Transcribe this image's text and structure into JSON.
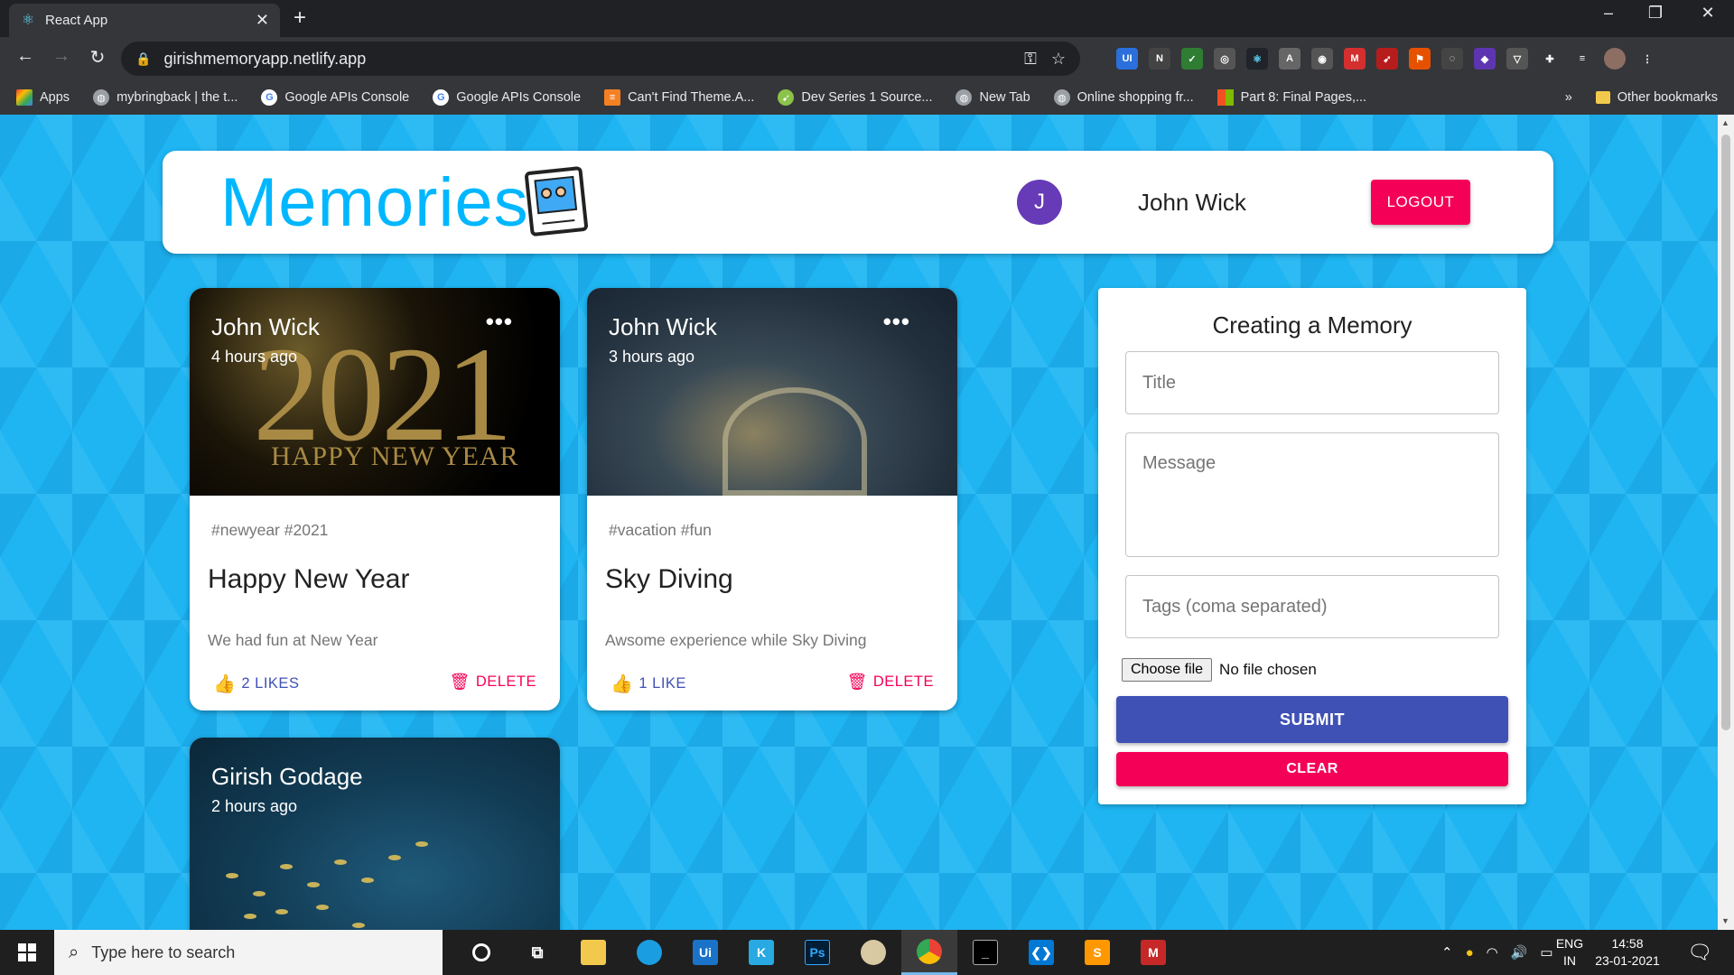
{
  "browser": {
    "tab_title": "React App",
    "tab_close": "✕",
    "new_tab": "+",
    "url": "girishmemoryapp.netlify.app",
    "window_controls": [
      "–",
      "❐",
      "✕"
    ]
  },
  "bookmarks": {
    "items": [
      {
        "label": "Apps",
        "icon": "apps-grid-icon",
        "color": "#ea4335"
      },
      {
        "label": "mybringback | the t...",
        "icon": "globe-icon",
        "color": "#9aa0a6"
      },
      {
        "label": "Google APIs Console",
        "icon": "google-icon",
        "color": "#ffffff"
      },
      {
        "label": "Google APIs Console",
        "icon": "google-icon",
        "color": "#ffffff"
      },
      {
        "label": "Can't Find Theme.A...",
        "icon": "stack-icon",
        "color": "#f48024"
      },
      {
        "label": "Dev Series 1 Source...",
        "icon": "rocket-icon",
        "color": "#8bc34a"
      },
      {
        "label": "New Tab",
        "icon": "globe-icon",
        "color": "#9aa0a6"
      },
      {
        "label": "Online shopping fr...",
        "icon": "globe-icon",
        "color": "#9aa0a6"
      },
      {
        "label": "Part 8: Final Pages,...",
        "icon": "microsoft-icon",
        "color": "#f25022"
      }
    ],
    "overflow": "»",
    "other": "Other bookmarks"
  },
  "header": {
    "brand": "Memories",
    "avatar_letter": "J",
    "user_name": "John Wick",
    "logout_label": "LOGOUT"
  },
  "posts": [
    {
      "author": "John Wick",
      "time": "4 hours ago",
      "image_text": "2021",
      "image_subtext": "HAPPY NEW YEAR",
      "tags": "#newyear #2021",
      "title": "Happy New Year",
      "message": "We had fun at New Year",
      "likes": "2 LIKES",
      "delete": "DELETE"
    },
    {
      "author": "John Wick",
      "time": "3 hours ago",
      "tags": "#vacation #fun",
      "title": "Sky Diving",
      "message": "Awsome experience while Sky Diving",
      "likes": "1 LIKE",
      "delete": "DELETE"
    },
    {
      "author": "Girish Godage",
      "time": "2 hours ago"
    }
  ],
  "form": {
    "title": "Creating a Memory",
    "title_placeholder": "Title",
    "message_placeholder": "Message",
    "tags_placeholder": "Tags (coma separated)",
    "file_button": "Choose file",
    "file_status": "No file chosen",
    "submit_label": "SUBMIT",
    "clear_label": "CLEAR"
  },
  "taskbar": {
    "search_placeholder": "Type here to search",
    "lang_top": "ENG",
    "lang_bottom": "IN",
    "time": "14:58",
    "date": "23-01-2021"
  },
  "colors": {
    "primary": "#3f51b5",
    "secondary": "#f50057",
    "brand": "#00b7ff",
    "avatar": "#673ab7"
  }
}
